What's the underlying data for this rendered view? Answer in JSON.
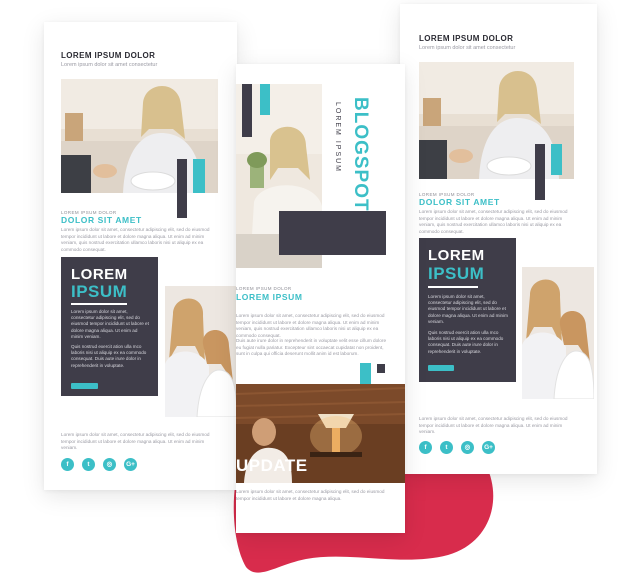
{
  "colors": {
    "teal": "#3cbfc7",
    "dark": "#3f3d49",
    "blob": "#d82c4c"
  },
  "left": {
    "header_title": "LOREM IPSUM DOLOR",
    "header_sub": "Lorem ipsum dolor sit amet consectetur",
    "kicker": "LOREM IPSUM DOLOR",
    "heading": "DOLOR SIT AMET",
    "para": "Lorem ipsum dolor sit amet, consectetur adipiscing elit, sed do eiusmod tempor incididunt ut labore et dolore magna aliqua. Ut enim ad minim veniam, quis nostrud exercitation ullamco laboris nisi ut aliquip ex ea commodo consequat.",
    "panel_lorem": "LOREM",
    "panel_ipsum": "IPSUM",
    "panel_text1": "Lorem ipsum dolor sit amet, consectetur adipiscing elit, sed do eiusmod tempor incididunt ut labore et dolore magna aliqua. Ut enim ad minim veniam.",
    "panel_text2": "Quis nostrud exercit ation ulla mco laboris nisi ut aliquip ex ea commodo consequat. Duis aute irure dolor in reprehenderit in voluptate.",
    "footer_para": "Lorem ipsum dolor sit amet, consectetur adipiscing elit, sed do eiusmod tempor incididunt ut labore et dolore magna aliqua. Ut enim ad minim veniam."
  },
  "middle": {
    "brand": "BLOGSPOT",
    "brand_sub": "LOREM IPSUM",
    "kicker": "LOREM IPSUM DOLOR",
    "heading": "LOREM IPSUM",
    "para1": "Lorem ipsum dolor sit amet, consectetur adipiscing elit, sed do eiusmod tempor incididunt ut labore et dolore magna aliqua. Ut enim ad minim veniam, quis nostrud exercitation ullamco laboris nisi ut aliquip ex ea commodo consequat.",
    "para2": "Duis aute irure dolor in reprehenderit in voluptate velit esse cillum dolore eu fugiat nulla pariatur. Excepteur sint occaecat cupidatat non proident, sunt in culpa qui officia deserunt mollit anim id est laborum.",
    "update": "UPDATE",
    "footer_para": "Lorem ipsum dolor sit amet, consectetur adipiscing elit, sed do eiusmod tempor incididunt ut labore et dolore magna aliqua."
  },
  "right": {
    "header_title": "LOREM IPSUM DOLOR",
    "header_sub": "Lorem ipsum dolor sit amet consectetur",
    "kicker": "LOREM IPSUM DOLOR",
    "heading": "DOLOR SIT AMET",
    "para": "Lorem ipsum dolor sit amet, consectetur adipiscing elit, sed do eiusmod tempor incididunt ut labore et dolore magna aliqua. Ut enim ad minim veniam, quis nostrud exercitation ullamco laboris nisi ut aliquip ex ea commodo consequat.",
    "panel_lorem": "LOREM",
    "panel_ipsum": "IPSUM",
    "panel_text1": "Lorem ipsum dolor sit amet, consectetur adipiscing elit, sed do eiusmod tempor incididunt ut labore et dolore magna aliqua. Ut enim ad minim veniam.",
    "panel_text2": "Quis nostrud exercit ation ulla mco laboris nisi ut aliquip ex ea commodo consequat. Duis aute irure dolor in reprehenderit in voluptate.",
    "footer_para": "Lorem ipsum dolor sit amet, consectetur adipiscing elit, sed do eiusmod tempor incididunt ut labore et dolore magna aliqua. Ut enim ad minim veniam."
  },
  "social_icons": [
    "facebook-icon",
    "twitter-icon",
    "instagram-icon",
    "google-plus-icon"
  ],
  "social_glyphs": {
    "facebook": "f",
    "twitter": "t",
    "instagram": "◎",
    "google": "G+"
  }
}
